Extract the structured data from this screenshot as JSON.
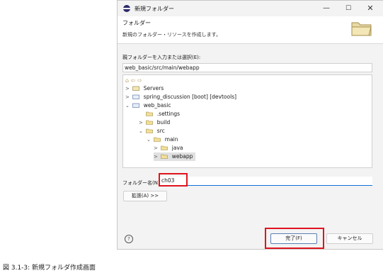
{
  "window": {
    "title": "新規フォルダー",
    "min_label": "—",
    "max_label": "☐",
    "close_label": "✕"
  },
  "header": {
    "title": "フォルダー",
    "subtitle": "新規のフォルダー・リソースを作成します。"
  },
  "parent": {
    "label": "親フォルダーを入力または選択(E):",
    "value": "web_basic/src/main/webapp"
  },
  "tree_toolbar": "⌂ ⇦ ⇨",
  "tree": [
    {
      "label": "Servers",
      "chev": ">"
    },
    {
      "label": "spring_discussion [boot] [devtools]",
      "chev": ">"
    },
    {
      "label": "web_basic",
      "chev": "⌄"
    },
    {
      "label": ".settings",
      "chev": ""
    },
    {
      "label": "build",
      "chev": ">"
    },
    {
      "label": "src",
      "chev": "⌄"
    },
    {
      "label": "main",
      "chev": "⌄"
    },
    {
      "label": "java",
      "chev": ">"
    },
    {
      "label": "webapp",
      "chev": ">"
    }
  ],
  "folder_name": {
    "label": "フォルダー名(N):",
    "value": "ch03"
  },
  "advanced_button": "拡張(A) >>",
  "help_symbol": "?",
  "finish_button": "完了(F)",
  "cancel_button": "キャンセル",
  "caption": "図 3.1-3: 新規フォルダ作成画面"
}
